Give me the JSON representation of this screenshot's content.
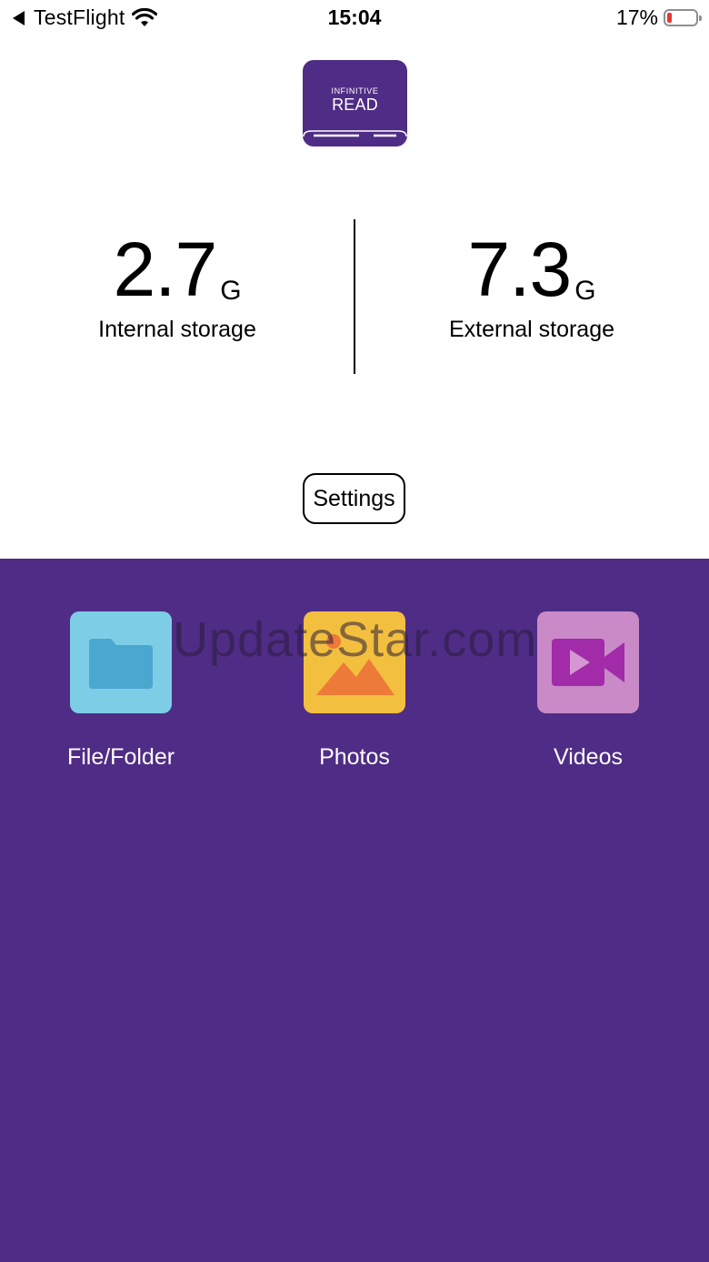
{
  "status_bar": {
    "back_label": "TestFlight",
    "time": "15:04",
    "battery_percent": "17%",
    "battery_level": 0.17,
    "icons": [
      "back-arrow-icon",
      "wifi-icon",
      "battery-icon"
    ]
  },
  "logo": {
    "line1": "INFINITIVE",
    "line2": "READ",
    "color": "#4f2c85"
  },
  "storage": {
    "internal": {
      "amount": "2.7",
      "unit": "G",
      "label": "Internal storage"
    },
    "external": {
      "amount": "7.3",
      "unit": "G",
      "label": "External storage"
    }
  },
  "settings_button": {
    "label": "Settings"
  },
  "media_panel": {
    "background": "#4f2c85",
    "watermark": "UpdateStar.com",
    "tiles": [
      {
        "label": "File/Folder",
        "icon": "folder-icon",
        "color": "#7ecde6"
      },
      {
        "label": "Photos",
        "icon": "photo-icon",
        "color": "#f3bf3e"
      },
      {
        "label": "Videos",
        "icon": "video-camera-icon",
        "color": "#c98ac7"
      }
    ]
  }
}
